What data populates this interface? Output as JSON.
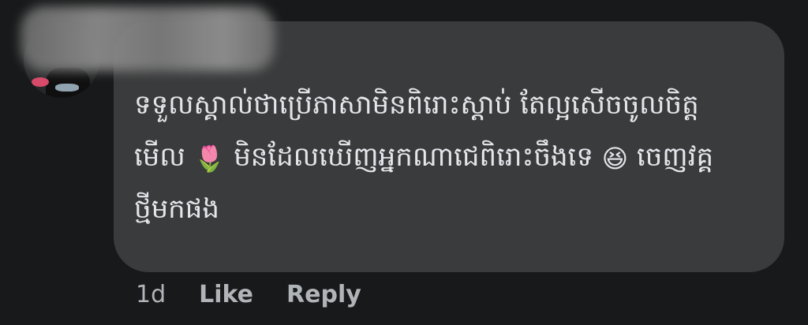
{
  "comment": {
    "text_line1": "ទទួលស្គាល់ថាប្រើភាសាមិនពិរោះស្ដាប់ តែល្អសើចចូលចិត្ត",
    "text_line2_a": "មើល",
    "emoji_tulip": "🌷",
    "text_line2_b": " មិនដែលឃើញអ្នកណាជេពិរោះចឹងទេ",
    "emoji_laugh": "😆",
    "text_line2_c": " ចេញវគ្គ",
    "text_line3": "ថ្មីមកផង"
  },
  "actions": {
    "time": "1d",
    "like": "Like",
    "reply": "Reply"
  }
}
